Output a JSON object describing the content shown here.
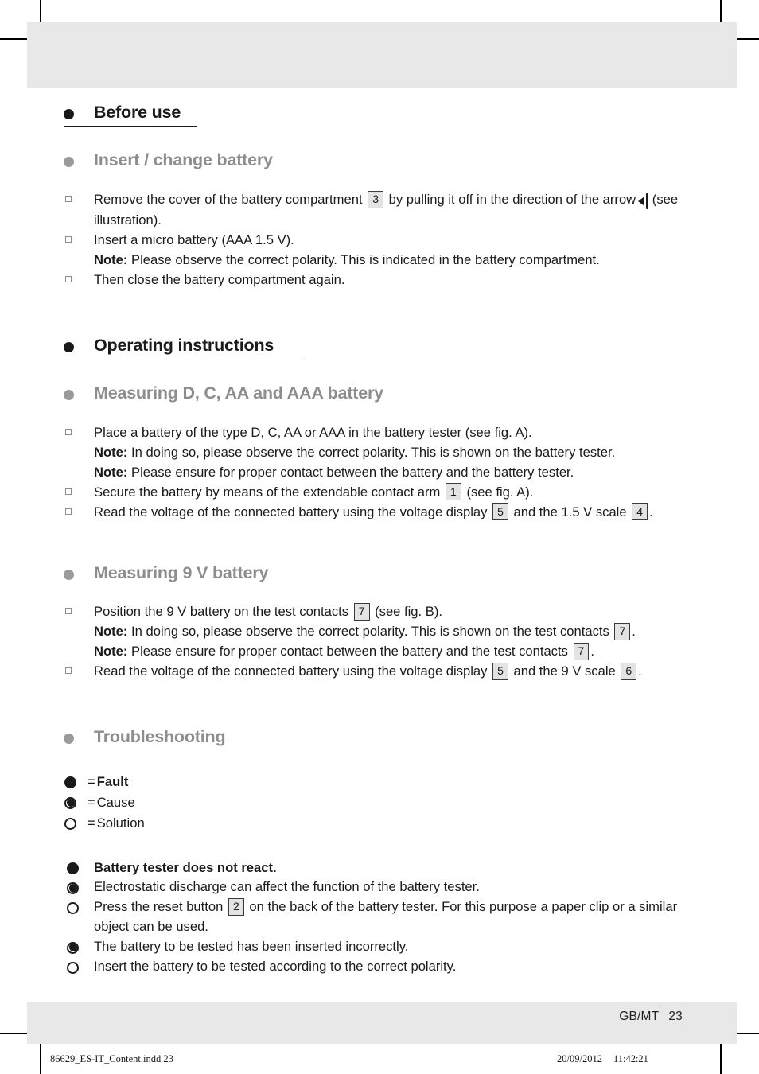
{
  "page": {
    "folio_label": "GB/MT",
    "folio_number": "23"
  },
  "slug": {
    "file": "86629_ES-IT_Content.indd  23",
    "date": "20/09/2012",
    "time": "11:42:21"
  },
  "sections": {
    "before_use": {
      "heading": "Before use",
      "subheading": "Insert / change battery",
      "steps": {
        "s1_a": "Remove the cover of the battery compartment",
        "s1_ref": "3",
        "s1_b": "by pulling it off in the direction of the arrow",
        "s1_c": "(see illustration).",
        "s2": "Insert a micro battery (AAA 1.5 V).",
        "s2_note_label": "Note:",
        "s2_note": "Please observe the correct polarity. This is indicated in the battery compartment.",
        "s3": "Then close the battery compartment again."
      }
    },
    "operating": {
      "heading": "Operating instructions",
      "sub_dcaa": {
        "subheading": "Measuring D, C, AA and AAA battery",
        "s1": "Place a battery of the type D, C, AA or AAA in the battery tester (see fig. A).",
        "note1_label": "Note:",
        "note1": "In doing so, please observe the correct polarity. This is shown on the battery tester.",
        "note2_label": "Note:",
        "note2": "Please ensure for proper contact between the battery and the battery tester.",
        "s2_a": "Secure the battery by means of the extendable contact arm",
        "s2_ref": "1",
        "s2_b": "(see fig. A).",
        "s3_a": "Read the voltage of the connected battery using the voltage display",
        "s3_ref1": "5",
        "s3_b": "and the 1.5 V scale",
        "s3_ref2": "4",
        "s3_c": "."
      },
      "sub_9v": {
        "subheading": "Measuring 9 V battery",
        "s1_a": "Position the 9 V battery on the test contacts",
        "s1_ref": "7",
        "s1_b": "(see fig. B).",
        "note1_label": "Note:",
        "note1_a": "In doing so, please observe the correct polarity. This is shown on the test contacts",
        "note1_ref": "7",
        "note1_b": ".",
        "note2_label": "Note:",
        "note2_a": "Please ensure for proper contact between the battery and the test contacts",
        "note2_ref": "7",
        "note2_b": ".",
        "s2_a": "Read the voltage of the connected battery using the voltage display",
        "s2_ref1": "5",
        "s2_b": "and the 9 V scale",
        "s2_ref2": "6",
        "s2_c": "."
      }
    },
    "troubleshooting": {
      "heading": "Troubleshooting",
      "legend": {
        "eq": "=",
        "fault": "Fault",
        "cause": "Cause",
        "solution": "Solution"
      },
      "items": {
        "fault": "Battery tester does not react.",
        "cause1": "Electrostatic discharge can affect the function of the battery tester.",
        "solution1_a": "Press the reset button",
        "solution1_ref": "2",
        "solution1_b": "on the back of the battery tester. For this purpose a paper clip or a similar object can be used.",
        "cause2": "The battery to be tested has been inserted incorrectly.",
        "solution2": "Insert the battery to be tested according to the correct polarity."
      }
    }
  }
}
